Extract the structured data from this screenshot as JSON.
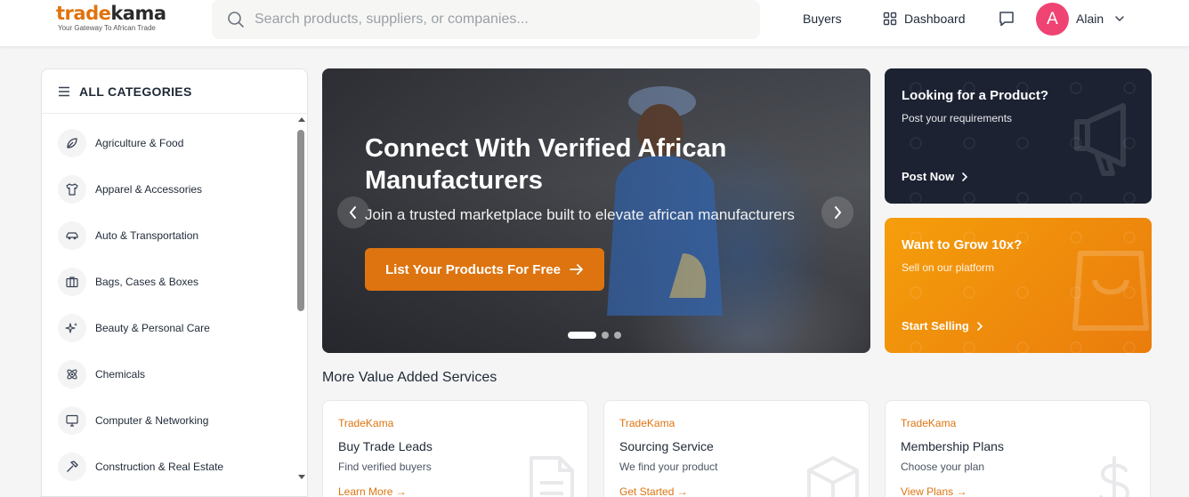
{
  "brand": {
    "name_part1": "trade",
    "name_part2": "kama",
    "tagline": "Your Gateway To African Trade",
    "accent_color": "#dd7410"
  },
  "search": {
    "placeholder": "Search products, suppliers, or companies...",
    "icon": "search-icon"
  },
  "nav": {
    "buyers_label": "Buyers",
    "dashboard_label": "Dashboard",
    "dashboard_icon": "grid-icon",
    "messages_icon": "chat-icon",
    "user_initial": "A",
    "user_name": "Alain",
    "avatar_color": "#ef4374"
  },
  "sidebar": {
    "title": "ALL CATEGORIES",
    "items": [
      {
        "label": "Agriculture & Food",
        "icon": "leaf-icon"
      },
      {
        "label": "Apparel & Accessories",
        "icon": "shirt-icon"
      },
      {
        "label": "Auto & Transportation",
        "icon": "car-icon"
      },
      {
        "label": "Bags, Cases & Boxes",
        "icon": "briefcase-icon"
      },
      {
        "label": "Beauty & Personal Care",
        "icon": "sparkles-icon"
      },
      {
        "label": "Chemicals",
        "icon": "atom-icon"
      },
      {
        "label": "Computer & Networking",
        "icon": "monitor-icon"
      },
      {
        "label": "Construction & Real Estate",
        "icon": "hammer-icon"
      }
    ]
  },
  "hero": {
    "title": "Connect With Verified African Manufacturers",
    "subtitle": "Join a trusted marketplace built to elevate african manufacturers",
    "button_label": "List Your Products For Free",
    "slide_count": 3,
    "active_slide": 1
  },
  "promos": [
    {
      "title": "Looking for a Product?",
      "subtitle": "Post your requirements",
      "cta": "Post Now",
      "icon": "megaphone-icon"
    },
    {
      "title": "Want to Grow 10x?",
      "subtitle": "Sell on our platform",
      "cta": "Start Selling",
      "icon": "shopping-bag-icon"
    }
  ],
  "services": {
    "heading": "More Value Added Services",
    "cards": [
      {
        "brand": "TradeKama",
        "title": "Buy Trade Leads",
        "subtitle": "Find verified buyers",
        "link": "Learn More →",
        "icon": "document-icon"
      },
      {
        "brand": "TradeKama",
        "title": "Sourcing Service",
        "subtitle": "We find your product",
        "link": "Get Started →",
        "icon": "box-icon"
      },
      {
        "brand": "TradeKama",
        "title": "Membership Plans",
        "subtitle": "Choose your plan",
        "link": "View Plans →",
        "icon": "dollar-icon"
      }
    ]
  }
}
